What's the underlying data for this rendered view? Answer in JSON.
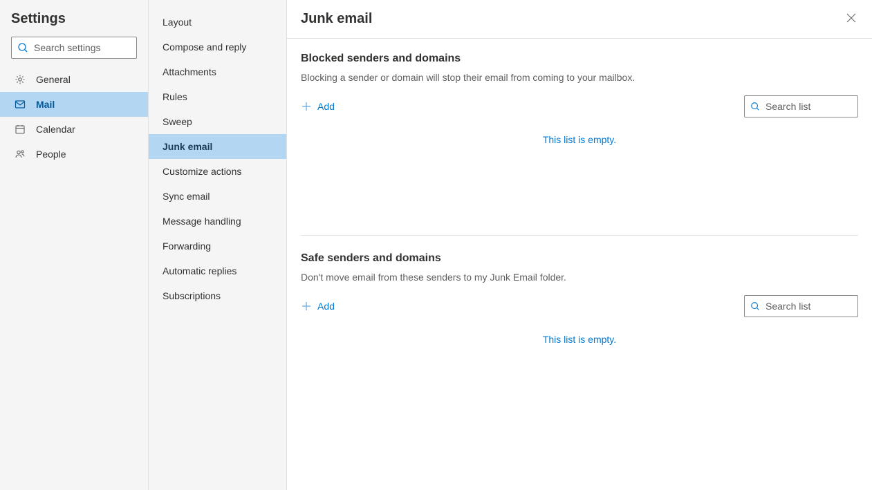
{
  "settings_title": "Settings",
  "search_settings_placeholder": "Search settings",
  "categories": [
    {
      "label": "General"
    },
    {
      "label": "Mail"
    },
    {
      "label": "Calendar"
    },
    {
      "label": "People"
    }
  ],
  "subcategories": [
    {
      "label": "Layout"
    },
    {
      "label": "Compose and reply"
    },
    {
      "label": "Attachments"
    },
    {
      "label": "Rules"
    },
    {
      "label": "Sweep"
    },
    {
      "label": "Junk email"
    },
    {
      "label": "Customize actions"
    },
    {
      "label": "Sync email"
    },
    {
      "label": "Message handling"
    },
    {
      "label": "Forwarding"
    },
    {
      "label": "Automatic replies"
    },
    {
      "label": "Subscriptions"
    }
  ],
  "main": {
    "title": "Junk email",
    "blocked": {
      "heading": "Blocked senders and domains",
      "description": "Blocking a sender or domain will stop their email from coming to your mailbox.",
      "add_label": "Add",
      "search_placeholder": "Search list",
      "empty_msg": "This list is empty."
    },
    "safe": {
      "heading": "Safe senders and domains",
      "description": "Don't move email from these senders to my Junk Email folder.",
      "add_label": "Add",
      "search_placeholder": "Search list",
      "empty_msg": "This list is empty."
    }
  }
}
